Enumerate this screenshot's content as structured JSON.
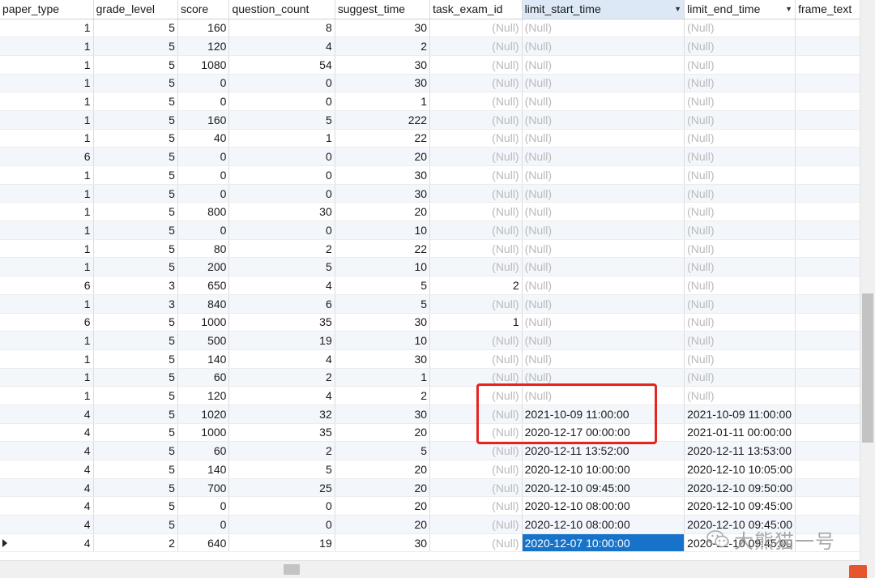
{
  "columns": [
    "paper_type",
    "grade_level",
    "score",
    "question_count",
    "suggest_time",
    "task_exam_id",
    "limit_start_time",
    "limit_end_time",
    "frame_text"
  ],
  "sorted_column_index": 6,
  "null_text": "(Null)",
  "rows": [
    [
      "1",
      "5",
      "160",
      "8",
      "30",
      "(Null)",
      "(Null)",
      "(Null)"
    ],
    [
      "1",
      "5",
      "120",
      "4",
      "2",
      "(Null)",
      "(Null)",
      "(Null)"
    ],
    [
      "1",
      "5",
      "1080",
      "54",
      "30",
      "(Null)",
      "(Null)",
      "(Null)"
    ],
    [
      "1",
      "5",
      "0",
      "0",
      "30",
      "(Null)",
      "(Null)",
      "(Null)"
    ],
    [
      "1",
      "5",
      "0",
      "0",
      "1",
      "(Null)",
      "(Null)",
      "(Null)"
    ],
    [
      "1",
      "5",
      "160",
      "5",
      "222",
      "(Null)",
      "(Null)",
      "(Null)"
    ],
    [
      "1",
      "5",
      "40",
      "1",
      "22",
      "(Null)",
      "(Null)",
      "(Null)"
    ],
    [
      "6",
      "5",
      "0",
      "0",
      "20",
      "(Null)",
      "(Null)",
      "(Null)"
    ],
    [
      "1",
      "5",
      "0",
      "0",
      "30",
      "(Null)",
      "(Null)",
      "(Null)"
    ],
    [
      "1",
      "5",
      "0",
      "0",
      "30",
      "(Null)",
      "(Null)",
      "(Null)"
    ],
    [
      "1",
      "5",
      "800",
      "30",
      "20",
      "(Null)",
      "(Null)",
      "(Null)"
    ],
    [
      "1",
      "5",
      "0",
      "0",
      "10",
      "(Null)",
      "(Null)",
      "(Null)"
    ],
    [
      "1",
      "5",
      "80",
      "2",
      "22",
      "(Null)",
      "(Null)",
      "(Null)"
    ],
    [
      "1",
      "5",
      "200",
      "5",
      "10",
      "(Null)",
      "(Null)",
      "(Null)"
    ],
    [
      "6",
      "3",
      "650",
      "4",
      "5",
      "2",
      "(Null)",
      "(Null)"
    ],
    [
      "1",
      "3",
      "840",
      "6",
      "5",
      "(Null)",
      "(Null)",
      "(Null)"
    ],
    [
      "6",
      "5",
      "1000",
      "35",
      "30",
      "1",
      "(Null)",
      "(Null)"
    ],
    [
      "1",
      "5",
      "500",
      "19",
      "10",
      "(Null)",
      "(Null)",
      "(Null)"
    ],
    [
      "1",
      "5",
      "140",
      "4",
      "30",
      "(Null)",
      "(Null)",
      "(Null)"
    ],
    [
      "1",
      "5",
      "60",
      "2",
      "1",
      "(Null)",
      "(Null)",
      "(Null)"
    ],
    [
      "1",
      "5",
      "120",
      "4",
      "2",
      "(Null)",
      "(Null)",
      "(Null)"
    ],
    [
      "4",
      "5",
      "1020",
      "32",
      "30",
      "(Null)",
      "2021-10-09 11:00:00",
      "2021-10-09 11:00:00"
    ],
    [
      "4",
      "5",
      "1000",
      "35",
      "20",
      "(Null)",
      "2020-12-17 00:00:00",
      "2021-01-11 00:00:00"
    ],
    [
      "4",
      "5",
      "60",
      "2",
      "5",
      "(Null)",
      "2020-12-11 13:52:00",
      "2020-12-11 13:53:00"
    ],
    [
      "4",
      "5",
      "140",
      "5",
      "20",
      "(Null)",
      "2020-12-10 10:00:00",
      "2020-12-10 10:05:00"
    ],
    [
      "4",
      "5",
      "700",
      "25",
      "20",
      "(Null)",
      "2020-12-10 09:45:00",
      "2020-12-10 09:50:00"
    ],
    [
      "4",
      "5",
      "0",
      "0",
      "20",
      "(Null)",
      "2020-12-10 08:00:00",
      "2020-12-10 09:45:00"
    ],
    [
      "4",
      "5",
      "0",
      "0",
      "20",
      "(Null)",
      "2020-12-10 08:00:00",
      "2020-12-10 09:45:00"
    ],
    [
      "4",
      "2",
      "640",
      "19",
      "30",
      "(Null)",
      "2020-12-07 10:00:00",
      "2020-12-10 09:45:00"
    ]
  ],
  "selected_cell": {
    "row": 28,
    "col": 6
  },
  "watermark_text": "大熊猫一号",
  "colors": {
    "selection": "#1673c9",
    "highlight_box": "#e52421",
    "null_text": "#b9b9b9"
  }
}
